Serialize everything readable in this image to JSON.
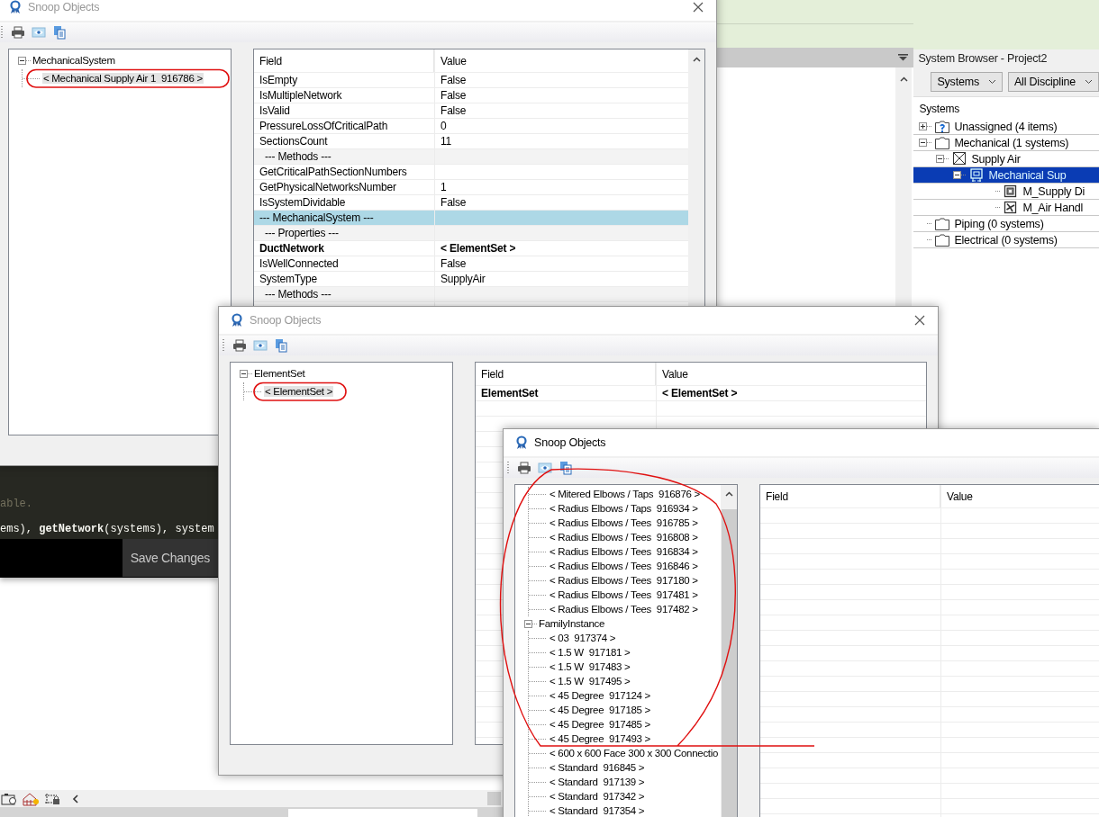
{
  "revit": {
    "system_browser": {
      "title": "System Browser - Project2",
      "filters": [
        {
          "label": "Systems"
        },
        {
          "label": "All Discipline"
        }
      ],
      "tree_heading": "Systems",
      "tree": [
        {
          "label": "Unassigned (4 items)",
          "kind": "unassigned",
          "expanded": false,
          "selected": false
        },
        {
          "label": "Mechanical (1 systems)",
          "kind": "folder",
          "expanded": true,
          "selected": false,
          "children": [
            {
              "label": "Supply Air",
              "kind": "system-type",
              "expanded": true,
              "selected": false,
              "children": [
                {
                  "label": "Mechanical Sup",
                  "kind": "system",
                  "expanded": true,
                  "selected": true,
                  "children": [
                    {
                      "label": "M_Supply Di",
                      "kind": "diffuser",
                      "selected": false
                    },
                    {
                      "label": "M_Air Handl",
                      "kind": "air-handler",
                      "selected": false
                    }
                  ]
                }
              ]
            }
          ]
        },
        {
          "label": "Piping (0 systems)",
          "kind": "folder",
          "selected": false
        },
        {
          "label": "Electrical (0 systems)",
          "kind": "folder",
          "selected": false
        }
      ]
    },
    "code_editor": {
      "lines": [
        {
          "text": "able.",
          "kind": "comment"
        },
        {
          "text": "ems), **getNetwork**(systems), system",
          "kind": "code"
        }
      ],
      "save_button": "Save Changes"
    }
  },
  "windows": [
    {
      "title": "Snoop Objects",
      "active": false,
      "tree": [
        {
          "label": "MechanicalSystem",
          "expanded": true,
          "selected": false,
          "children": [
            {
              "label": "< Mechanical Supply Air 1  916786 >",
              "selected": true
            }
          ]
        }
      ],
      "grid": {
        "columns": [
          "Field",
          "Value"
        ],
        "rows": [
          {
            "kind": "property",
            "field": "IsEmpty",
            "value": "False",
            "selected": false
          },
          {
            "kind": "property",
            "field": "IsMultipleNetwork",
            "value": "False",
            "selected": false
          },
          {
            "kind": "property",
            "field": "IsValid",
            "value": "False",
            "selected": false
          },
          {
            "kind": "property",
            "field": "PressureLossOfCriticalPath",
            "value": "0",
            "selected": false
          },
          {
            "kind": "property",
            "field": "SectionsCount",
            "value": "11",
            "selected": false
          },
          {
            "kind": "section",
            "field": "--- Methods ---",
            "selected": false
          },
          {
            "kind": "property",
            "field": "GetCriticalPathSectionNumbers",
            "selected": false
          },
          {
            "kind": "property",
            "field": "GetPhysicalNetworksNumber",
            "value": "1",
            "selected": false
          },
          {
            "kind": "property",
            "field": "IsSystemDividable",
            "value": "False",
            "selected": false
          },
          {
            "kind": "category",
            "field": "--- MechanicalSystem ---",
            "selected": true
          },
          {
            "kind": "section",
            "field": "--- Properties ---",
            "selected": false
          },
          {
            "kind": "object",
            "field": "DuctNetwork",
            "value": "< ElementSet >",
            "selected": false
          },
          {
            "kind": "property",
            "field": "IsWellConnected",
            "value": "False",
            "selected": false
          },
          {
            "kind": "property",
            "field": "SystemType",
            "value": "SupplyAir",
            "selected": false
          },
          {
            "kind": "section",
            "field": "--- Methods ---",
            "selected": false
          }
        ]
      }
    },
    {
      "title": "Snoop Objects",
      "active": false,
      "tree": [
        {
          "label": "ElementSet",
          "expanded": true,
          "selected": false,
          "children": [
            {
              "label": "< ElementSet >",
              "selected": true
            }
          ]
        }
      ],
      "grid": {
        "columns": [
          "Field",
          "Value"
        ],
        "rows": [
          {
            "kind": "object",
            "field": "ElementSet",
            "value": "< ElementSet >",
            "selected": false
          }
        ]
      }
    },
    {
      "title": "Snoop Objects",
      "active": true,
      "tree": [
        {
          "children": [
            {
              "label": "< Mitered Elbows / Taps  916876 >",
              "selected": false
            },
            {
              "label": "< Radius Elbows / Taps  916934 >",
              "selected": false
            },
            {
              "label": "< Radius Elbows / Tees  916785 >",
              "selected": false
            },
            {
              "label": "< Radius Elbows / Tees  916808 >",
              "selected": false
            },
            {
              "label": "< Radius Elbows / Tees  916834 >",
              "selected": false
            },
            {
              "label": "< Radius Elbows / Tees  916846 >",
              "selected": false
            },
            {
              "label": "< Radius Elbows / Tees  917180 >",
              "selected": false
            },
            {
              "label": "< Radius Elbows / Tees  917481 >",
              "selected": false
            },
            {
              "label": "< Radius Elbows / Tees  917482 >",
              "selected": false
            }
          ]
        },
        {
          "label": "FamilyInstance",
          "expanded": true,
          "selected": false,
          "children": [
            {
              "label": "< 03  917374 >",
              "selected": false
            },
            {
              "label": "< 1.5 W  917181 >",
              "selected": false
            },
            {
              "label": "< 1.5 W  917483 >",
              "selected": false
            },
            {
              "label": "< 1.5 W  917495 >",
              "selected": false
            },
            {
              "label": "< 45 Degree  917124 >",
              "selected": false
            },
            {
              "label": "< 45 Degree  917185 >",
              "selected": false
            },
            {
              "label": "< 45 Degree  917485 >",
              "selected": false
            },
            {
              "label": "< 45 Degree  917493 >",
              "selected": false
            },
            {
              "label": "< 600 x 600 Face 300 x 300 Connectio",
              "selected": false
            },
            {
              "label": "< Standard  916845 >",
              "selected": false
            },
            {
              "label": "< Standard  917139 >",
              "selected": false
            },
            {
              "label": "< Standard  917342 >",
              "selected": false
            },
            {
              "label": "< Standard  917354 >",
              "selected": false
            }
          ]
        }
      ],
      "grid": {
        "columns": [
          "Field",
          "Value"
        ]
      }
    }
  ]
}
